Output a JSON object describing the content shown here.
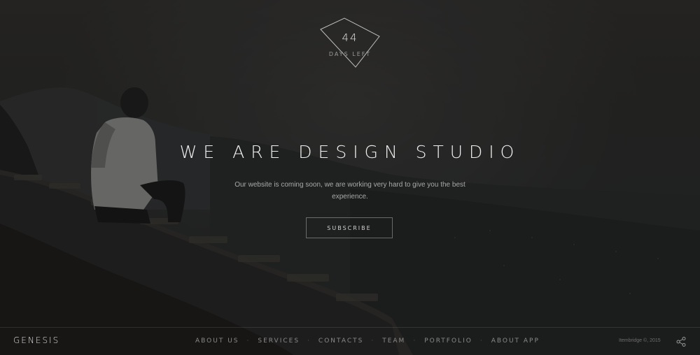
{
  "countdown": {
    "days": "44",
    "label": "DAYS LEFT"
  },
  "hero": {
    "title": "WE ARE DESIGN STUDIO",
    "subtitle": "Our website is coming soon, we are working very hard to give you the best experience.",
    "subscribe_label": "SUBSCRIBE"
  },
  "footer": {
    "brand": "GENESIS",
    "nav": [
      {
        "label": "ABOUT US"
      },
      {
        "label": "SERVICES"
      },
      {
        "label": "CONTACTS"
      },
      {
        "label": "TEAM"
      },
      {
        "label": "PORTFOLIO"
      },
      {
        "label": "ABOUT APP"
      }
    ],
    "copyright": "Itembridge ©, 2015",
    "share_icon": "share-icon"
  },
  "colors": {
    "text_primary": "#f0f0f0",
    "text_muted": "#a9a9a9",
    "nav_text": "#8a8a8a",
    "background": "#252626"
  }
}
